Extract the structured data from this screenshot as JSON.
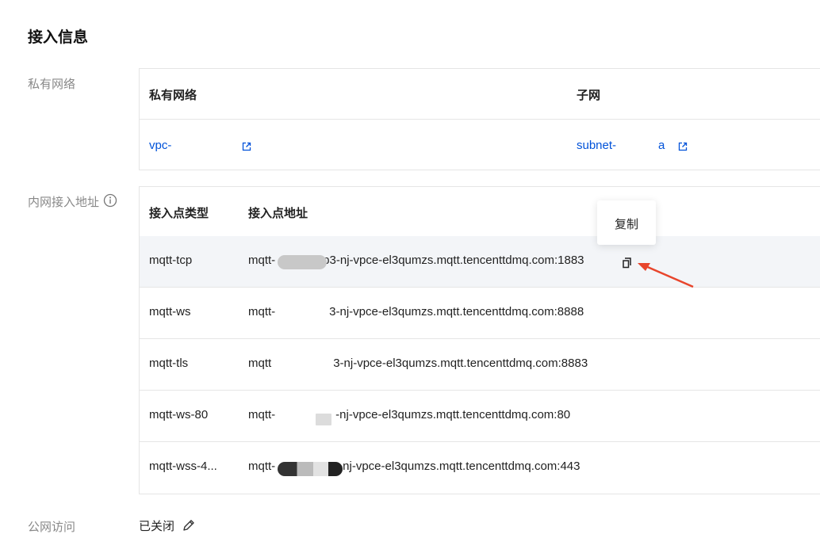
{
  "section": {
    "title": "接入信息"
  },
  "vpc": {
    "label": "私有网络",
    "col_vpc": "私有网络",
    "col_subnet": "子网",
    "vpc_value": "vpc-",
    "subnet_value_prefix": "subnet-",
    "subnet_value_suffix": "a"
  },
  "endpoints": {
    "label": "内网接入地址",
    "col_type": "接入点类型",
    "col_addr": "接入点地址",
    "rows": [
      {
        "type": "mqtt-tcp",
        "addr_prefix": "mqtt-",
        "addr_suffix": "p3-nj-vpce-el3qumzs.mqtt.tencenttdmq.com:1883"
      },
      {
        "type": "mqtt-ws",
        "addr_prefix": "mqtt-",
        "addr_suffix": "3-nj-vpce-el3qumzs.mqtt.tencenttdmq.com:8888"
      },
      {
        "type": "mqtt-tls",
        "addr_prefix": "mqtt",
        "addr_suffix": "3-nj-vpce-el3qumzs.mqtt.tencenttdmq.com:8883"
      },
      {
        "type": "mqtt-ws-80",
        "addr_prefix": "mqtt-",
        "addr_suffix": "-nj-vpce-el3qumzs.mqtt.tencenttdmq.com:80"
      },
      {
        "type": "mqtt-wss-4...",
        "addr_prefix": "mqtt-",
        "addr_suffix": "-nj-vpce-el3qumzs.mqtt.tencenttdmq.com:443"
      }
    ],
    "tooltip": "复制"
  },
  "public": {
    "label": "公网访问",
    "value": "已关闭"
  },
  "icons": {
    "external_link": "external-link-icon",
    "info": "info-icon",
    "copy": "copy-icon",
    "edit": "pencil-icon"
  },
  "colors": {
    "link": "#0052d9",
    "annotation_arrow": "#e8452c"
  }
}
